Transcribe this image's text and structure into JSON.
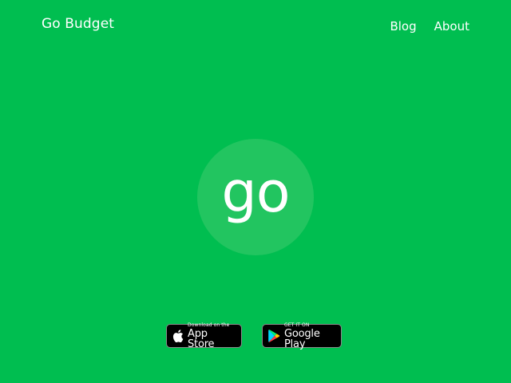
{
  "header": {
    "brand": "Go Budget",
    "nav": [
      {
        "label": "Blog"
      },
      {
        "label": "About"
      }
    ]
  },
  "hero": {
    "logo_text": "go"
  },
  "badges": {
    "app_store": {
      "small": "Download on the",
      "big": "App Store",
      "icon": "apple-icon"
    },
    "google_play": {
      "small": "GET IT ON",
      "big": "Google Play",
      "icon": "google-play-icon"
    }
  },
  "colors": {
    "background": "#00BE50",
    "logo_circle": "#22C560",
    "text": "#FFFFFF",
    "badge_bg": "#000000"
  }
}
